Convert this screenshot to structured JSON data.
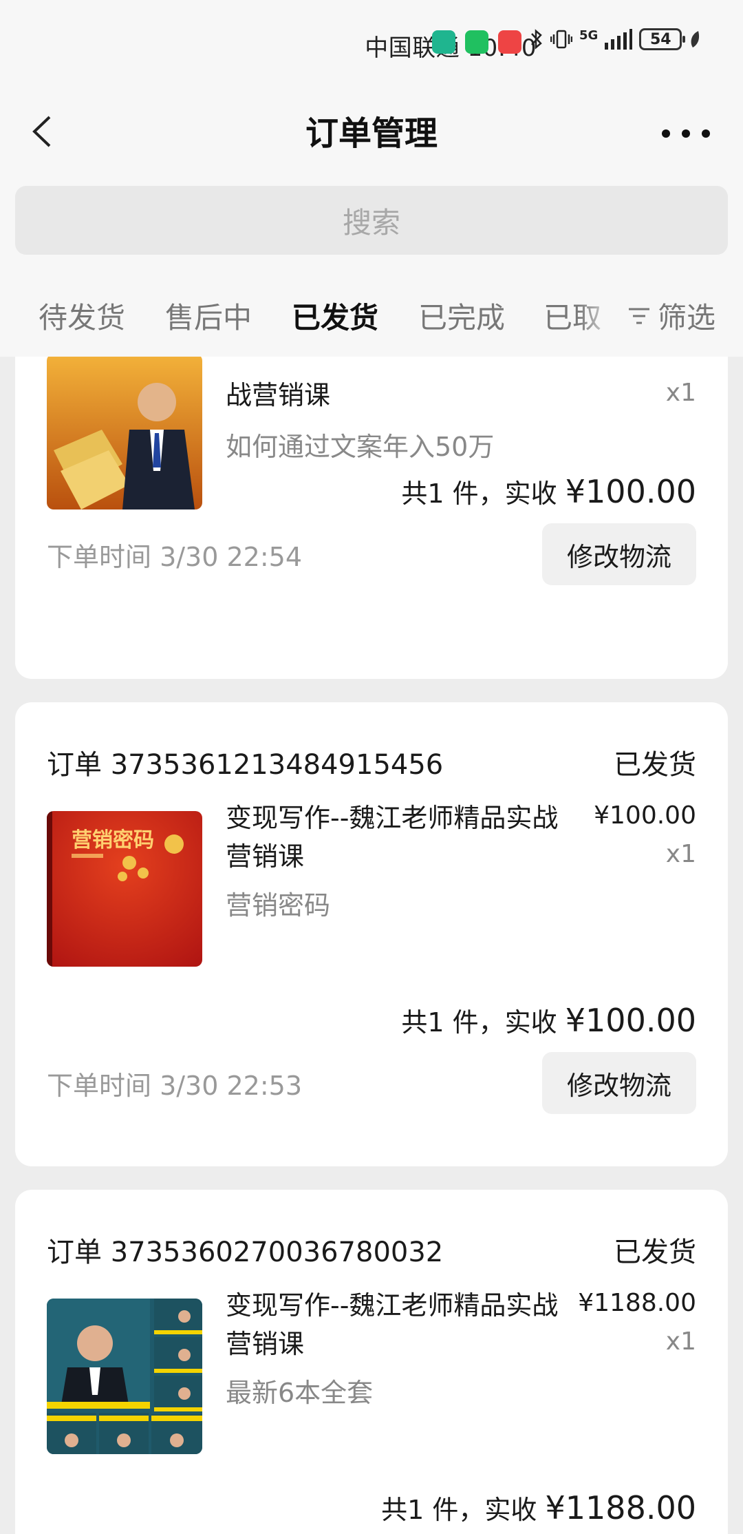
{
  "status_bar": {
    "carrier_time": "中国联通 10:40",
    "network": "5G",
    "battery": "54"
  },
  "header": {
    "title": "订单管理"
  },
  "search": {
    "placeholder": "搜索"
  },
  "tabs": [
    {
      "label": "待发货"
    },
    {
      "label": "售后中"
    },
    {
      "label": "已发货"
    },
    {
      "label": "已完成"
    },
    {
      "label": "已取"
    }
  ],
  "filter_label": "筛选",
  "orders": [
    {
      "order_no": "",
      "status": "",
      "product_title": "战营销课",
      "product_sub": "如何通过文案年入50万",
      "price": "",
      "qty": "x1",
      "total_prefix": "共1 件，实收 ",
      "total_amount": "¥100.00",
      "order_time": "下单时间 3/30 22:54",
      "action": "修改物流"
    },
    {
      "order_no": "订单 3735361213484915456",
      "status": "已发货",
      "product_title": "变现写作--魏江老师精品实战营销课",
      "product_sub": "营销密码",
      "price": "¥100.00",
      "qty": "x1",
      "total_prefix": "共1 件，实收 ",
      "total_amount": "¥100.00",
      "order_time": "下单时间 3/30 22:53",
      "action": "修改物流"
    },
    {
      "order_no": "订单 3735360270036780032",
      "status": "已发货",
      "product_title": "变现写作--魏江老师精品实战营销课",
      "product_sub": "最新6本全套",
      "price": "¥1188.00",
      "qty": "x1",
      "total_prefix": "共1 件，实收 ",
      "total_amount": "¥1188.00",
      "order_time": "",
      "action": ""
    }
  ],
  "cover_text": {
    "book2": "营销密码"
  }
}
